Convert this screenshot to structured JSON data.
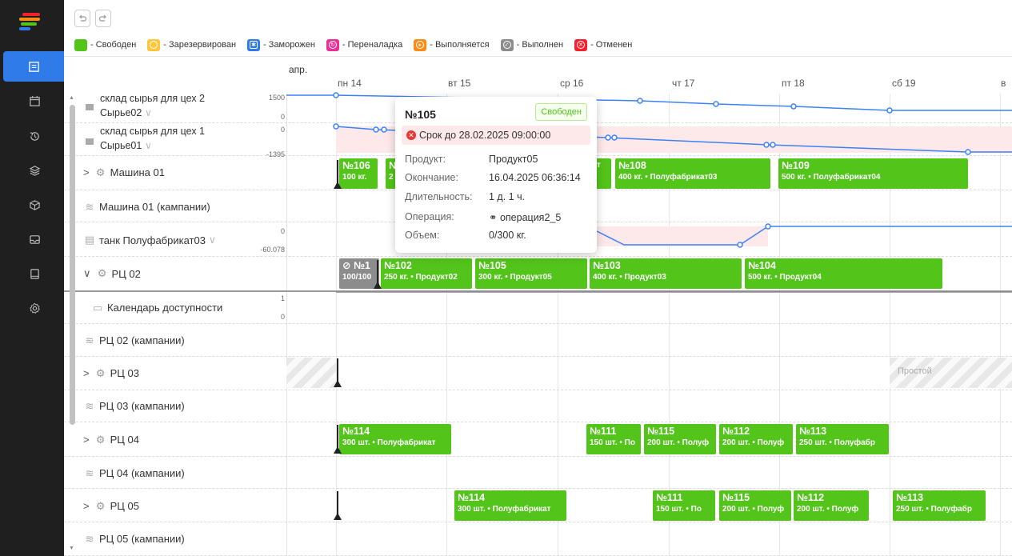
{
  "toolbar": {
    "undo": "undo-icon",
    "redo": "redo-icon"
  },
  "legend": [
    {
      "label": "- Свободен",
      "color": "#52c41a",
      "icon": "none"
    },
    {
      "label": "- Зарезервирован",
      "color": "#ffc53d",
      "icon": "circle"
    },
    {
      "label": "- Заморожен",
      "color": "#2f7be7",
      "icon": "snowflake"
    },
    {
      "label": "- Переналадка",
      "color": "#eb2f96",
      "icon": "refresh"
    },
    {
      "label": "- Выполняется",
      "color": "#fa8c16",
      "icon": "play"
    },
    {
      "label": "- Выполнен",
      "color": "#8c8c8c",
      "icon": "check"
    },
    {
      "label": "- Отменен",
      "color": "#f5222d",
      "icon": "cross"
    }
  ],
  "timeline": {
    "month": "апр.",
    "days": [
      "пн 14",
      "вт 15",
      "ср 16",
      "чт 17",
      "пт 18",
      "сб 19",
      "в"
    ]
  },
  "rows": {
    "wh2_title": "склад сырья для цех 2",
    "wh2_sub": "Сырье02",
    "wh2_max": "1500",
    "wh2_min": "0",
    "wh1_title": "склад сырья для цех 1",
    "wh1_sub": "Сырье01",
    "wh1_max": "0",
    "wh1_min": "-1395",
    "m01": "Машина 01",
    "m01c": "Машина 01 (кампании)",
    "tank": "танк  Полуфабрикат03",
    "tank_max": "0",
    "tank_min": "-60.078",
    "rc02": "РЦ 02",
    "cal": "Календарь доступности",
    "cal_max": "1",
    "cal_min": "0",
    "rc02c": "РЦ 02 (кампании)",
    "rc03": "РЦ 03",
    "rc03c": "РЦ 03 (кампании)",
    "rc04": "РЦ 04",
    "rc04c": "РЦ 04 (кампании)",
    "rc05": "РЦ 05",
    "rc05c": "РЦ 05 (кампании)"
  },
  "tasks": {
    "m01_a": {
      "n": "№106",
      "d": "100 кг."
    },
    "m01_b": {
      "n": "№",
      "d": "2"
    },
    "m01_c": {
      "n": "",
      "d": "т"
    },
    "m01_108": {
      "n": "№108",
      "d": "400 кг. • Полуфабрикат03"
    },
    "m01_109": {
      "n": "№109",
      "d": "500 кг. • Полуфабрикат04"
    },
    "rc02_done": {
      "n": "⊘ №1",
      "d": "100/100"
    },
    "rc02_102": {
      "n": "№102",
      "d": "250 кг. • Продукт02"
    },
    "rc02_105": {
      "n": "№105",
      "d": "300 кг. • Продукт05"
    },
    "rc02_103": {
      "n": "№103",
      "d": "400 кг. • Продукт03"
    },
    "rc02_104": {
      "n": "№104",
      "d": "500 кг. • Продукт04"
    },
    "rc03_idle": "Простой",
    "rc04_114": {
      "n": "№114",
      "d": "300 шт. • Полуфабрикат"
    },
    "rc04_111": {
      "n": "№111",
      "d": "150 шт. • По"
    },
    "rc04_115": {
      "n": "№115",
      "d": "200 шт. • Полуф"
    },
    "rc04_112": {
      "n": "№112",
      "d": "200 шт. • Полуф"
    },
    "rc04_113": {
      "n": "№113",
      "d": "250 шт. • Полуфабр"
    },
    "rc05_114": {
      "n": "№114",
      "d": "300 шт. • Полуфабрикат"
    },
    "rc05_111": {
      "n": "№111",
      "d": "150 шт. • По"
    },
    "rc05_115": {
      "n": "№115",
      "d": "200 шт. • Полуф"
    },
    "rc05_112": {
      "n": "№112",
      "d": "200 шт. • Полуф"
    },
    "rc05_113": {
      "n": "№113",
      "d": "250 шт. • Полуфабр"
    }
  },
  "tooltip": {
    "title": "№105",
    "badge": "Свободен",
    "deadline": "Срок до 28.02.2025 09:00:00",
    "product_label": "Продукт:",
    "product": "Продукт05",
    "end_label": "Окончание:",
    "end": "16.04.2025 06:36:14",
    "dur_label": "Длительность:",
    "dur": "1 д. 1 ч.",
    "op_label": "Операция:",
    "op": "операция2_5",
    "vol_label": "Объем:",
    "vol": "0/300 кг."
  },
  "colors": {
    "free": "#52c41a",
    "accent": "#2f7be7",
    "sidebar": "#1f1f1f",
    "line": "#3b82f6",
    "deficit": "#fde9e9"
  }
}
